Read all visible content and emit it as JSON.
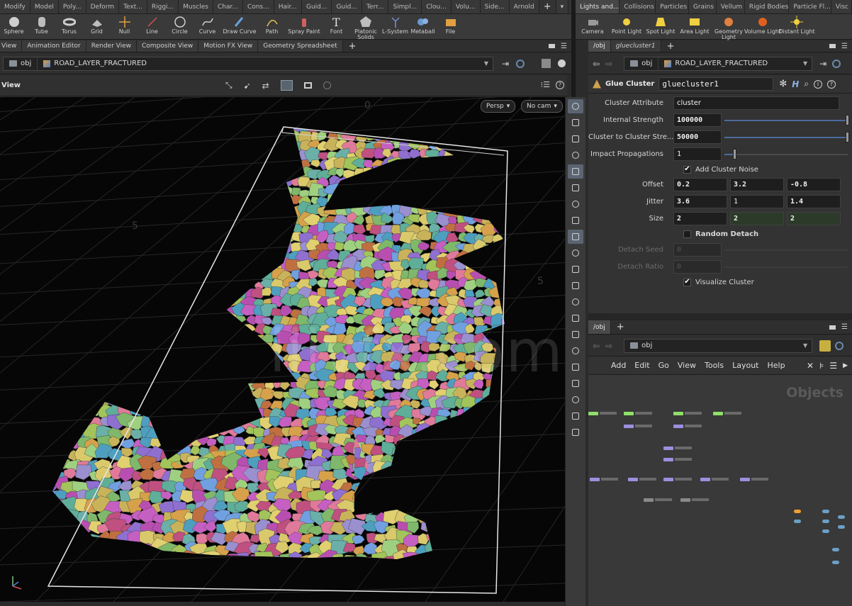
{
  "shelf": {
    "left_tabs": [
      "Modify",
      "Model",
      "Poly...",
      "Deform",
      "Text...",
      "Riggi...",
      "Muscles",
      "Char...",
      "Cons...",
      "Hair...",
      "Guid...",
      "Guid...",
      "Terr...",
      "Simpl...",
      "Clou...",
      "Volu...",
      "Side...",
      "Arnold"
    ],
    "right_tabs": [
      "Lights and...",
      "Collisions",
      "Particles",
      "Grains",
      "Vellum",
      "Rigid Bodies",
      "Particle Fl...",
      "Visc"
    ],
    "left_tools": [
      {
        "label": "Sphere",
        "icon": "sphere-icon"
      },
      {
        "label": "Tube",
        "icon": "tube-icon"
      },
      {
        "label": "Torus",
        "icon": "torus-icon"
      },
      {
        "label": "Grid",
        "icon": "grid-icon"
      },
      {
        "label": "Null",
        "icon": "null-icon"
      },
      {
        "label": "Line",
        "icon": "line-icon"
      },
      {
        "label": "Circle",
        "icon": "circle-icon"
      },
      {
        "label": "Curve",
        "icon": "curve-icon"
      },
      {
        "label": "Draw Curve",
        "icon": "draw-curve-icon"
      },
      {
        "label": "Path",
        "icon": "path-icon"
      },
      {
        "label": "Spray Paint",
        "icon": "spray-paint-icon"
      },
      {
        "label": "Font",
        "icon": "font-icon"
      },
      {
        "label": "Platonic Solids",
        "icon": "platonic-solids-icon"
      },
      {
        "label": "L-System",
        "icon": "l-system-icon"
      },
      {
        "label": "Metaball",
        "icon": "metaball-icon"
      },
      {
        "label": "File",
        "icon": "file-icon"
      }
    ],
    "right_tools": [
      {
        "label": "Camera",
        "icon": "camera-icon"
      },
      {
        "label": "Point Light",
        "icon": "point-light-icon"
      },
      {
        "label": "Spot Light",
        "icon": "spot-light-icon"
      },
      {
        "label": "Area Light",
        "icon": "area-light-icon"
      },
      {
        "label": "Geometry Light",
        "icon": "geometry-light-icon"
      },
      {
        "label": "Volume Light",
        "icon": "volume-light-icon"
      },
      {
        "label": "Distant Light",
        "icon": "distant-light-icon"
      }
    ]
  },
  "pane_tabs": {
    "left": [
      "View",
      "Animation Editor",
      "Render View",
      "Composite View",
      "Motion FX View",
      "Geometry Spreadsheet"
    ],
    "right": [
      "/obj",
      "gluecluster1"
    ],
    "network": [
      "/obj"
    ]
  },
  "viewer": {
    "path_root": "obj",
    "path_node": "ROAD_LAYER_FRACTURED",
    "header_label": "View",
    "persp_label": "Persp",
    "cam_label": "No cam",
    "grid_label_a": "5",
    "grid_label_b": "5",
    "grid_label_c": "0",
    "watermark": "iiivfx.com"
  },
  "params": {
    "path_root": "obj",
    "path_node": "ROAD_LAYER_FRACTURED",
    "node_type": "Glue Cluster",
    "node_name": "gluecluster1",
    "cluster_attribute_label": "Cluster Attribute",
    "cluster_attribute_value": "cluster",
    "internal_strength_label": "Internal Strength",
    "internal_strength_value": "100000",
    "c2c_strength_label": "Cluster to Cluster Stre...",
    "c2c_strength_value": "50000",
    "impact_label": "Impact Propagations",
    "impact_value": "1",
    "add_noise_label": "Add Cluster Noise",
    "add_noise_checked": true,
    "offset_label": "Offset",
    "offset": [
      "0.2",
      "3.2",
      "-0.8"
    ],
    "jitter_label": "Jitter",
    "jitter": [
      "3.6",
      "1",
      "1.4"
    ],
    "size_label": "Size",
    "size": [
      "2",
      "2",
      "2"
    ],
    "random_detach_label": "Random Detach",
    "random_detach_checked": false,
    "detach_seed_label": "Detach Seed",
    "detach_seed_value": "0",
    "detach_ratio_label": "Detach Ratio",
    "detach_ratio_value": "0",
    "visualize_label": "Visualize Cluster",
    "visualize_checked": true
  },
  "network": {
    "path_root": "obj",
    "menu": [
      "Add",
      "Edit",
      "Go",
      "View",
      "Tools",
      "Layout",
      "Help"
    ],
    "context_label": "Objects"
  },
  "colors": {
    "accent_blue": "#4b6b9c",
    "node_green": "#8fe06a",
    "node_purple": "#9d8fe0",
    "node_grey": "#8a8a8a",
    "node_orange": "#f0a030",
    "node_teal": "#6aa0c8"
  }
}
